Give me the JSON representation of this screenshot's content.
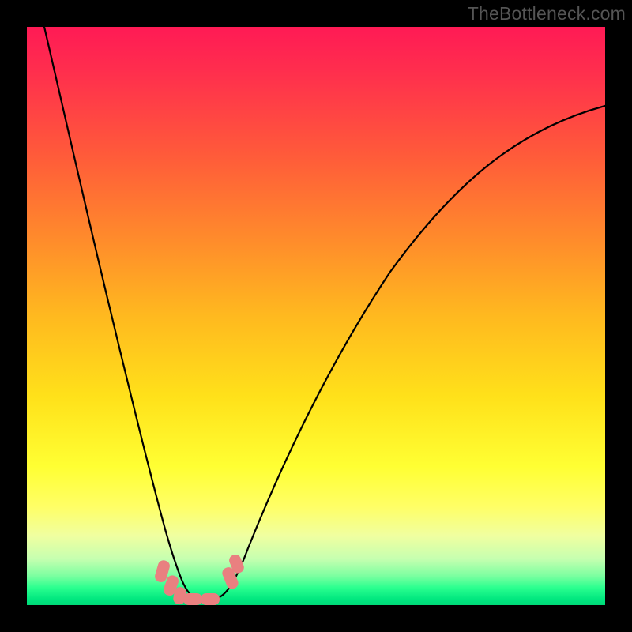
{
  "watermark": "TheBottleneck.com",
  "chart_data": {
    "type": "line",
    "title": "",
    "xlabel": "",
    "ylabel": "",
    "xlim": [
      0,
      1
    ],
    "ylim": [
      0,
      1
    ],
    "grid": false,
    "background_gradient": {
      "stops": [
        {
          "pos": 0.0,
          "color": "#ff1a55"
        },
        {
          "pos": 0.5,
          "color": "#ffd21a"
        },
        {
          "pos": 0.83,
          "color": "#ffff66"
        },
        {
          "pos": 1.0,
          "color": "#00d877"
        }
      ],
      "direction": "top-to-bottom"
    },
    "series": [
      {
        "name": "bottleneck-curve",
        "x": [
          0.03,
          0.06,
          0.09,
          0.12,
          0.15,
          0.18,
          0.21,
          0.235,
          0.255,
          0.27,
          0.285,
          0.3,
          0.32,
          0.345,
          0.38,
          0.43,
          0.49,
          0.55,
          0.62,
          0.7,
          0.8,
          0.9,
          1.0
        ],
        "y": [
          1.0,
          0.82,
          0.66,
          0.52,
          0.4,
          0.29,
          0.19,
          0.11,
          0.06,
          0.03,
          0.015,
          0.01,
          0.015,
          0.04,
          0.1,
          0.19,
          0.29,
          0.39,
          0.49,
          0.58,
          0.67,
          0.74,
          0.8
        ],
        "color": "#000000",
        "stroke_width": 2
      }
    ],
    "markers": [
      {
        "shape": "blob",
        "cx": 0.235,
        "cy": 0.055,
        "color": "#e98080"
      },
      {
        "shape": "blob",
        "cx": 0.248,
        "cy": 0.033,
        "color": "#e98080"
      },
      {
        "shape": "blob",
        "cx": 0.262,
        "cy": 0.018,
        "color": "#e98080"
      },
      {
        "shape": "blob",
        "cx": 0.278,
        "cy": 0.01,
        "color": "#e98080"
      },
      {
        "shape": "blob",
        "cx": 0.3,
        "cy": 0.01,
        "color": "#e98080"
      },
      {
        "shape": "blob",
        "cx": 0.322,
        "cy": 0.01,
        "color": "#e98080"
      },
      {
        "shape": "blob",
        "cx": 0.35,
        "cy": 0.038,
        "color": "#e98080"
      },
      {
        "shape": "blob",
        "cx": 0.358,
        "cy": 0.055,
        "color": "#e98080"
      }
    ]
  }
}
